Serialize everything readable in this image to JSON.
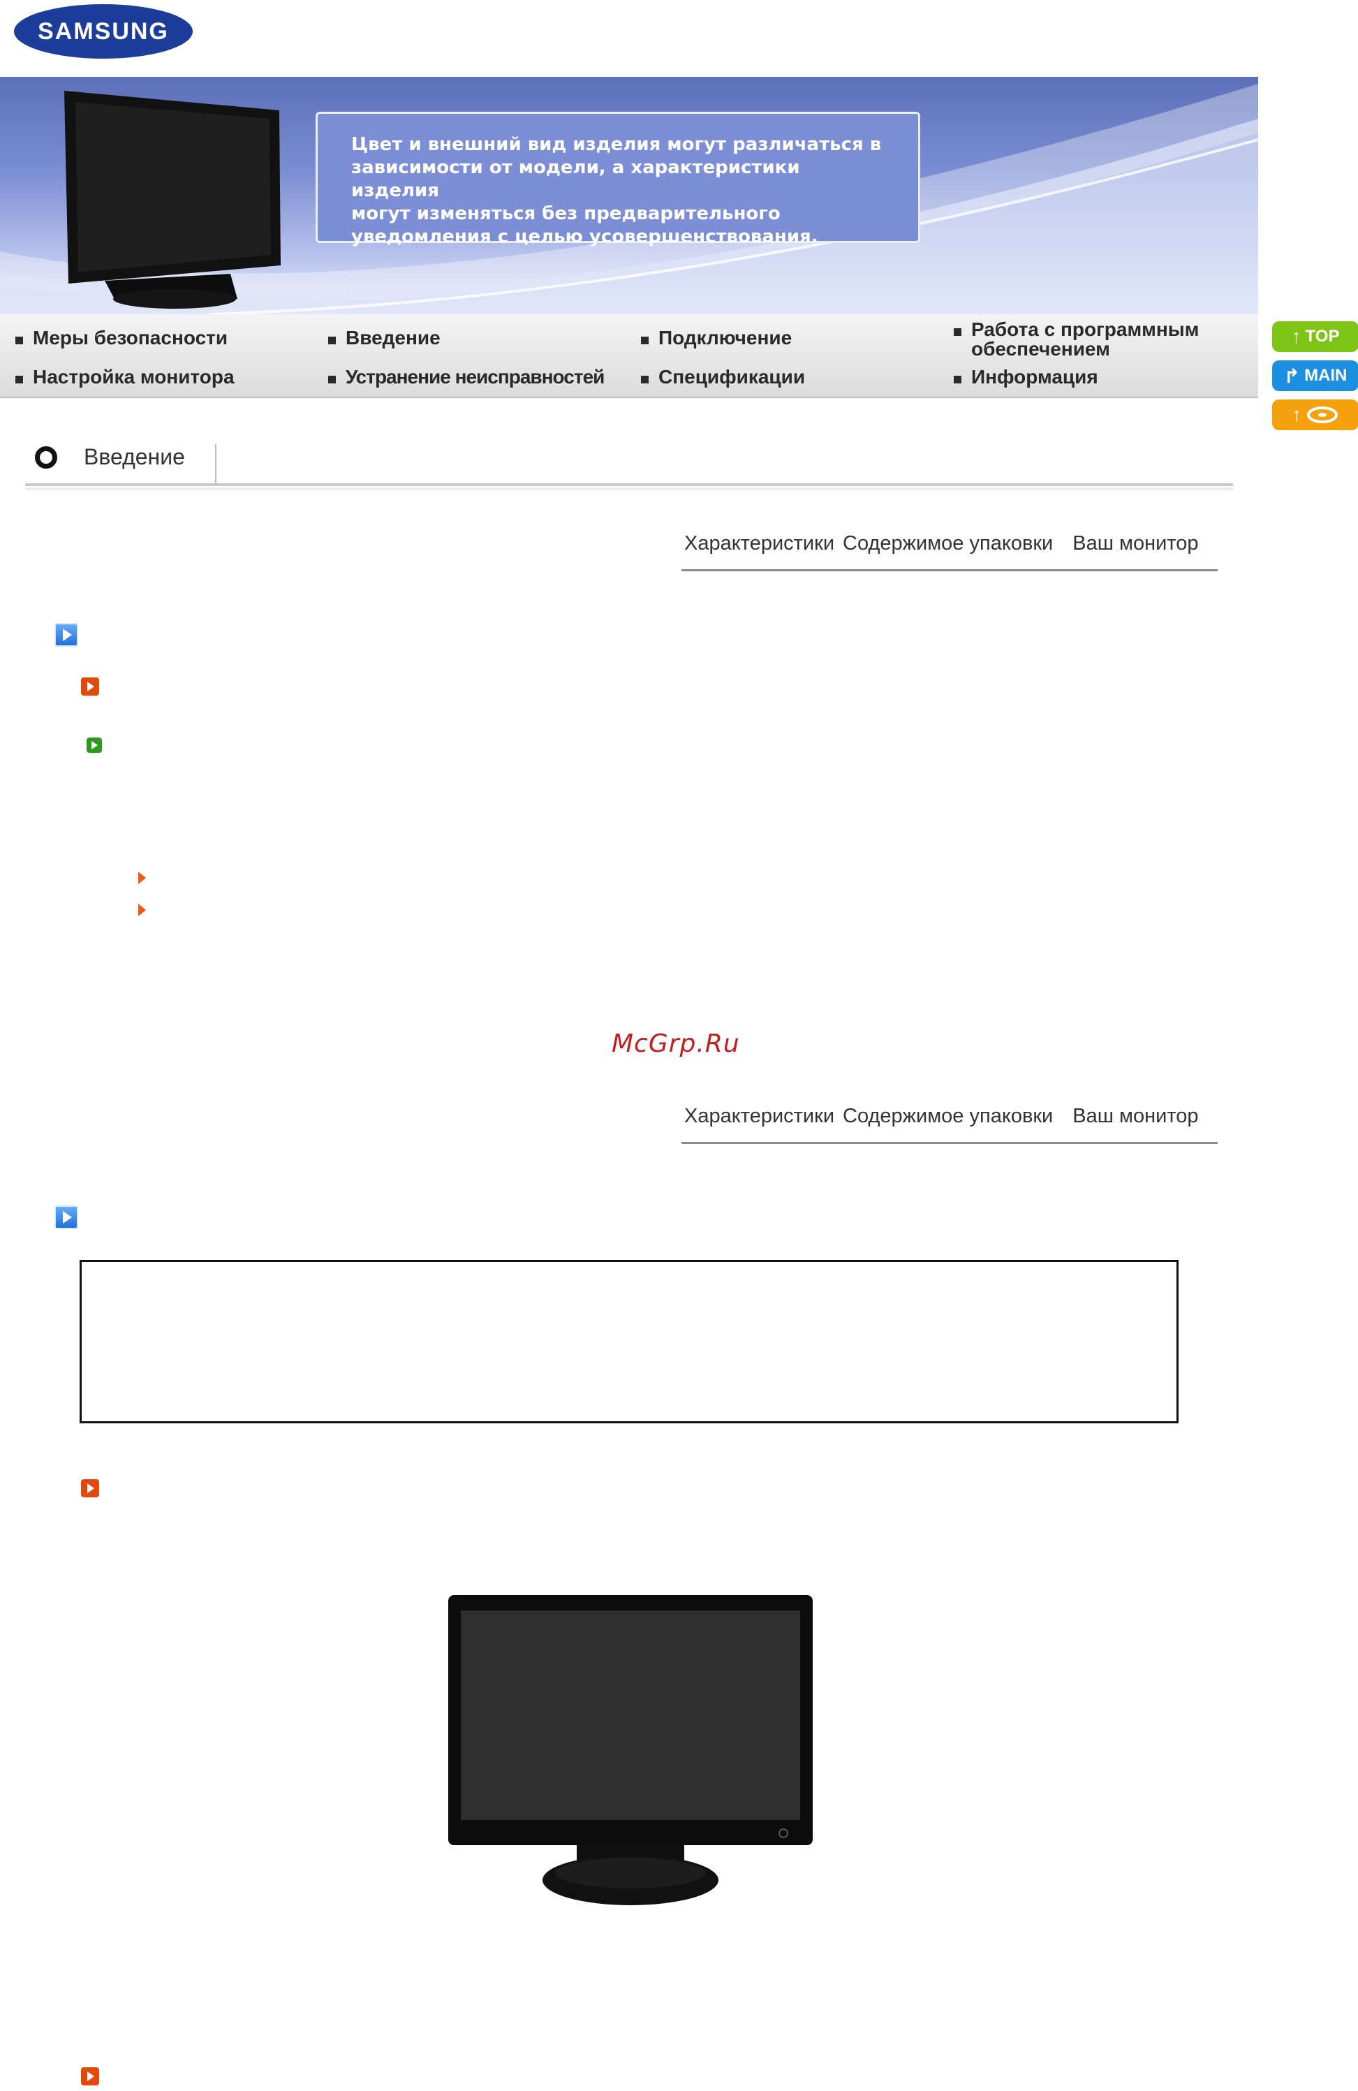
{
  "header": {
    "logo_text": "SAMSUNG",
    "colors": {
      "logo_blue": "#1c3d9a",
      "banner_blue": "#7c8fd6"
    }
  },
  "banner": {
    "note_lines": [
      "Цвет и внешний вид изделия могут различаться в",
      "зависимости от модели, а характеристики изделия",
      "могут изменяться без предварительного",
      "уведомления с целью усовершенствования."
    ]
  },
  "nav": {
    "items": [
      {
        "label": "Меры безопасности"
      },
      {
        "label": "Введение"
      },
      {
        "label": "Подключение"
      },
      {
        "label": "Работа с программным обеспечением"
      },
      {
        "label": "Настройка монитора"
      },
      {
        "label": "Устранение неисправностей"
      },
      {
        "label": "Спецификации"
      },
      {
        "label": "Информация"
      }
    ]
  },
  "side_buttons": {
    "top_label": "TOP",
    "main_label": "MAIN",
    "colors": {
      "top": "#7ec417",
      "main": "#1c8fe0",
      "back": "#f5a10e"
    },
    "icons": [
      "arrow-up-icon",
      "arrow-turn-icon",
      "disc-icon"
    ]
  },
  "section": {
    "title": "Введение"
  },
  "tabs": {
    "features": "Характеристики",
    "package": "Содержимое упаковки",
    "monitor": "Ваш монитор"
  },
  "watermark": "McGrp.Ru"
}
